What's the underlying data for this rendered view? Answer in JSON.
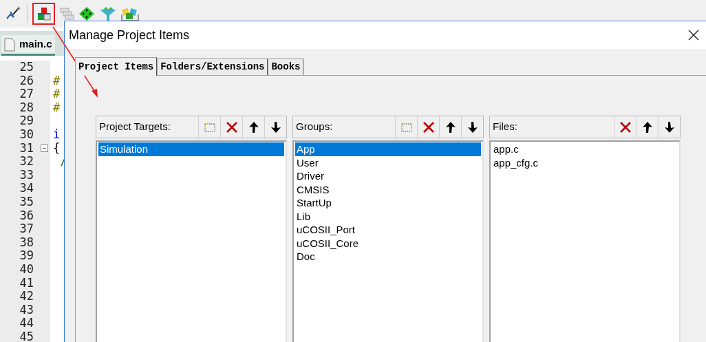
{
  "editor": {
    "tab": "main.c",
    "lines": [
      {
        "number": "25",
        "collapsible": false
      },
      {
        "number": "26",
        "code": "#",
        "kind": "preprocessor",
        "collapsible": false
      },
      {
        "number": "27",
        "code": "#",
        "kind": "preprocessor",
        "collapsible": false
      },
      {
        "number": "28",
        "code": "#",
        "kind": "preprocessor",
        "collapsible": false
      },
      {
        "number": "29",
        "collapsible": false
      },
      {
        "number": "30",
        "code": "i",
        "kind": "keyword",
        "collapsible": false
      },
      {
        "number": "31",
        "code": "{",
        "kind": "plain",
        "collapsible": true
      },
      {
        "number": "32",
        "code": " /",
        "kind": "comment",
        "collapsible": false
      },
      {
        "number": "33",
        "collapsible": false
      },
      {
        "number": "34",
        "collapsible": false
      },
      {
        "number": "35",
        "collapsible": false
      },
      {
        "number": "36",
        "collapsible": false
      },
      {
        "number": "37",
        "collapsible": false
      },
      {
        "number": "38",
        "collapsible": false
      },
      {
        "number": "39",
        "collapsible": false
      },
      {
        "number": "40",
        "collapsible": false
      },
      {
        "number": "41",
        "collapsible": false
      },
      {
        "number": "42",
        "collapsible": false
      },
      {
        "number": "43",
        "collapsible": false
      },
      {
        "number": "44",
        "collapsible": false
      },
      {
        "number": "45",
        "collapsible": false
      }
    ]
  },
  "toolbar": {
    "highlighted": true
  },
  "dialog": {
    "title": "Manage Project Items",
    "tabs": [
      {
        "label": "Project Items",
        "selected": true
      },
      {
        "label": "Folders/Extensions",
        "selected": false
      },
      {
        "label": "Books",
        "selected": false
      }
    ],
    "panels": [
      {
        "title": "Project Targets:",
        "buttons": [
          {
            "kind": "new"
          },
          {
            "kind": "delete"
          },
          {
            "kind": "up"
          },
          {
            "kind": "down"
          }
        ],
        "items": [
          {
            "label": "Simulation",
            "selected": true
          }
        ]
      },
      {
        "title": "Groups:",
        "buttons": [
          {
            "kind": "new"
          },
          {
            "kind": "delete"
          },
          {
            "kind": "up"
          },
          {
            "kind": "down"
          }
        ],
        "items": [
          {
            "label": "App",
            "selected": true
          },
          {
            "label": "User",
            "selected": false
          },
          {
            "label": "Driver",
            "selected": false
          },
          {
            "label": "CMSIS",
            "selected": false
          },
          {
            "label": "StartUp",
            "selected": false
          },
          {
            "label": "Lib",
            "selected": false
          },
          {
            "label": "uCOSII_Port",
            "selected": false
          },
          {
            "label": "uCOSII_Core",
            "selected": false
          },
          {
            "label": "Doc",
            "selected": false
          }
        ]
      },
      {
        "title": "Files:",
        "buttons": [
          {
            "kind": "delete"
          },
          {
            "kind": "up"
          },
          {
            "kind": "down"
          }
        ],
        "items": [
          {
            "label": "app.c",
            "selected": false
          },
          {
            "label": "app_cfg.c",
            "selected": false
          }
        ]
      }
    ]
  }
}
